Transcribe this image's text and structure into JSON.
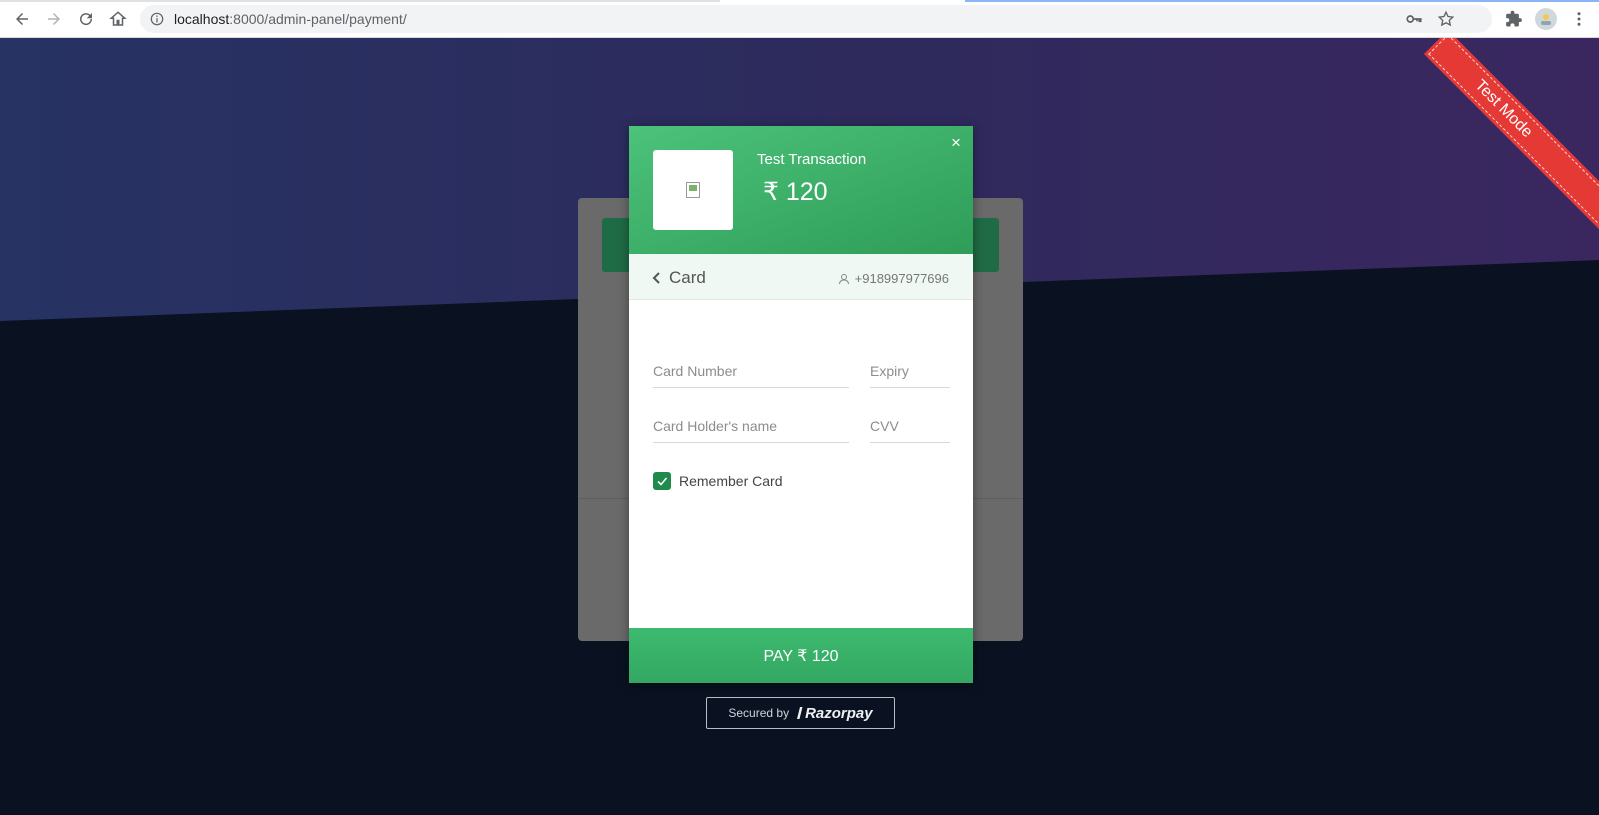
{
  "browser": {
    "url_host": "localhost",
    "url_rest": ":8000/admin-panel/payment/"
  },
  "ribbon": {
    "label": "Test Mode"
  },
  "checkout": {
    "merchant_name": "Test Transaction",
    "amount": "₹ 120",
    "method_label": "Card",
    "contact": "+918997977696",
    "fields": {
      "card_number_placeholder": "Card Number",
      "expiry_placeholder": "Expiry",
      "holder_placeholder": "Card Holder's name",
      "cvv_placeholder": "CVV"
    },
    "remember_label": "Remember Card",
    "remember_checked": true,
    "pay_label": "PAY ₹ 120",
    "close_symbol": "×"
  },
  "footer": {
    "secured_by": "Secured by",
    "brand": "Razorpay"
  },
  "colors": {
    "header_green": "#3cb46c",
    "pay_green": "#39b268",
    "ribbon_red": "#e53935",
    "hero": "#2b2f60",
    "page_dark": "#0a1120"
  }
}
